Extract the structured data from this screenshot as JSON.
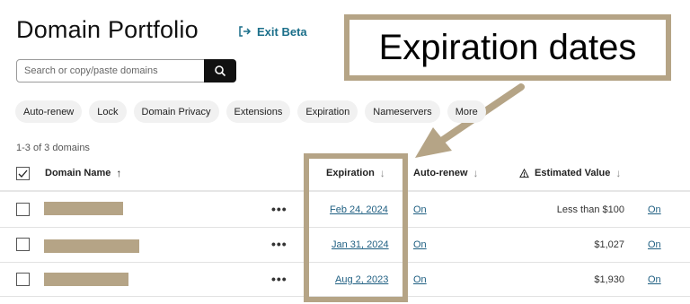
{
  "header": {
    "title": "Domain Portfolio",
    "exit_beta": "Exit Beta"
  },
  "callout": {
    "text": "Expiration dates"
  },
  "search": {
    "placeholder": "Search or copy/paste domains"
  },
  "filters": [
    "Auto-renew",
    "Lock",
    "Domain Privacy",
    "Extensions",
    "Expiration",
    "Nameservers",
    "More"
  ],
  "count": "1-3 of 3 domains",
  "columns": {
    "domain": "Domain Name",
    "expiration": "Expiration",
    "autorenew": "Auto-renew",
    "value": "Estimated Value"
  },
  "rows": [
    {
      "expiration": "Feb 24, 2024",
      "autorenew": "On",
      "value": "Less than $100",
      "value_link": "On"
    },
    {
      "expiration": "Jan 31, 2024",
      "autorenew": "On",
      "value": "$1,027",
      "value_link": "On"
    },
    {
      "expiration": "Aug 2, 2023",
      "autorenew": "On",
      "value": "$1,930",
      "value_link": "On"
    }
  ],
  "colors": {
    "accent": "#1b6f8a",
    "highlight": "#b5a486"
  },
  "icons": [
    "exit-icon",
    "search-icon",
    "sort-arrow-icon",
    "warning-icon",
    "more-dots-icon",
    "checkbox-icon"
  ]
}
